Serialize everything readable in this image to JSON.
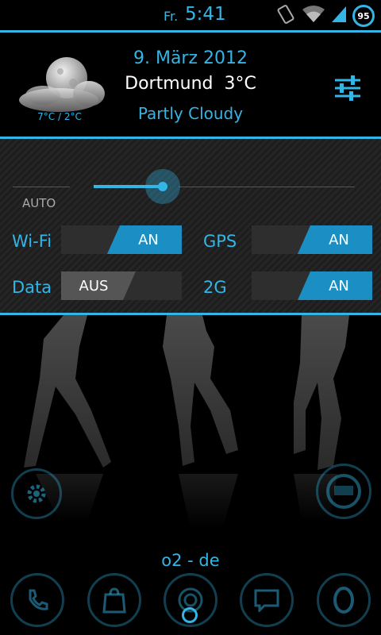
{
  "status_bar": {
    "day": "Fr.",
    "time": "5:41",
    "battery_level": "95",
    "icons": [
      "vibrate-icon",
      "wifi-icon",
      "signal-icon",
      "battery-icon"
    ]
  },
  "weather": {
    "date": "9. März 2012",
    "city": "Dortmund",
    "temperature": "3°C",
    "condition": "Partly Cloudy",
    "min_max": "7°C / 2°C"
  },
  "toggles": {
    "brightness_mode": "AUTO",
    "brightness_level": 0.38,
    "items": [
      {
        "label": "Wi-Fi",
        "state": "AN"
      },
      {
        "label": "GPS",
        "state": "AN"
      },
      {
        "label": "Data",
        "state": "AUS"
      },
      {
        "label": "2G",
        "state": "AN"
      }
    ]
  },
  "home": {
    "carrier": "o2 - de",
    "shortcuts": [
      "settings-icon",
      "titanium-backup-icon"
    ],
    "dock": [
      "phone-icon",
      "market-icon",
      "app-drawer-icon",
      "messaging-icon",
      "opera-icon"
    ]
  },
  "colors": {
    "accent": "#33b5e5",
    "switch_on": "#1b8fc4",
    "switch_off": "#555555"
  }
}
